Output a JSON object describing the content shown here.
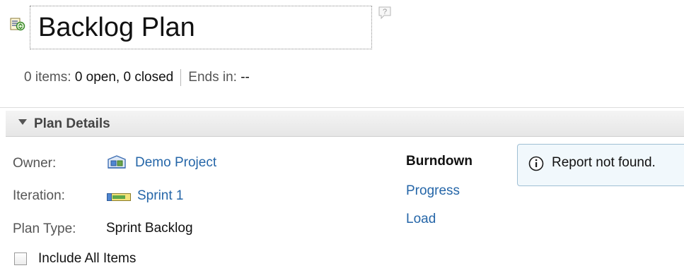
{
  "header": {
    "title": "Backlog Plan",
    "plan_icon": "plan-refresh-icon",
    "help_icon": "help-icon"
  },
  "summary": {
    "items": "0 items:",
    "open_closed": "0 open, 0 closed",
    "ends_label": "Ends in:",
    "ends_value": "--"
  },
  "section": {
    "title": "Plan Details",
    "toggle_icon": "expanded-triangle-icon"
  },
  "details": {
    "owner_label": "Owner:",
    "owner_value": "Demo Project",
    "owner_icon": "project-area-icon",
    "iteration_label": "Iteration:",
    "iteration_value": "Sprint 1",
    "iteration_icon": "iteration-icon",
    "plan_type_label": "Plan Type:",
    "plan_type_value": "Sprint Backlog",
    "include_all_label": "Include All Items",
    "include_all_checked": false
  },
  "charts": {
    "burndown": "Burndown",
    "progress": "Progress",
    "load": "Load"
  },
  "report": {
    "message": "Report not found.",
    "icon": "info-icon"
  },
  "colors": {
    "link": "#2566a8",
    "info_bg": "#f1f8fc",
    "info_border": "#9fbfd4"
  }
}
